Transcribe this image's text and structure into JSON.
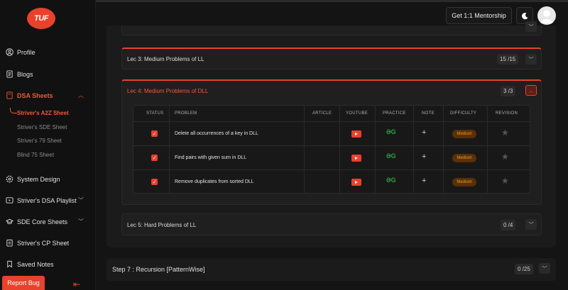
{
  "sidebar": {
    "logo": "TUF",
    "items": [
      {
        "label": "Profile"
      },
      {
        "label": "Blogs"
      },
      {
        "label": "DSA Sheets"
      },
      {
        "label": "System Design"
      },
      {
        "label": "Striver's DSA Playlist"
      },
      {
        "label": "SDE Core Sheets"
      },
      {
        "label": "Striver's CP Sheet"
      },
      {
        "label": "Saved Notes"
      }
    ],
    "sheets": [
      "Striver's A2Z Sheet",
      "Striver's SDE Sheet",
      "Striver's 79 Sheet",
      "Blind 75 Sheet"
    ],
    "report_bug": "Report Bug"
  },
  "header": {
    "mentorship": "Get 1:1 Mentorship"
  },
  "lectures": [
    {
      "title": "Lec 3: Medium Problems of LL",
      "count": "15 /15"
    },
    {
      "title": "Lec 4: Medium Problems of DLL",
      "count": "3 /3"
    },
    {
      "title": "Lec 5: Hard Problems of LL",
      "count": "0 /4"
    }
  ],
  "table": {
    "headers": [
      "STATUS",
      "PROBLEM",
      "ARTICLE",
      "YOUTUBE",
      "PRACTICE",
      "NOTE",
      "DIFFICULTY",
      "REVISION"
    ],
    "rows": [
      {
        "problem": "Delete all occurrences of a key in DLL",
        "difficulty": "Medium"
      },
      {
        "problem": "Find pairs with given sum in DLL",
        "difficulty": "Medium"
      },
      {
        "problem": "Remove duplicates from sorted DLL",
        "difficulty": "Medium"
      }
    ]
  },
  "step": {
    "title": "Step 7 : Recursion [PatternWise]",
    "count": "0 /25"
  },
  "colors": {
    "accent": "#e8412c",
    "practice": "#2f9e44",
    "medium": "#e89a2c"
  }
}
